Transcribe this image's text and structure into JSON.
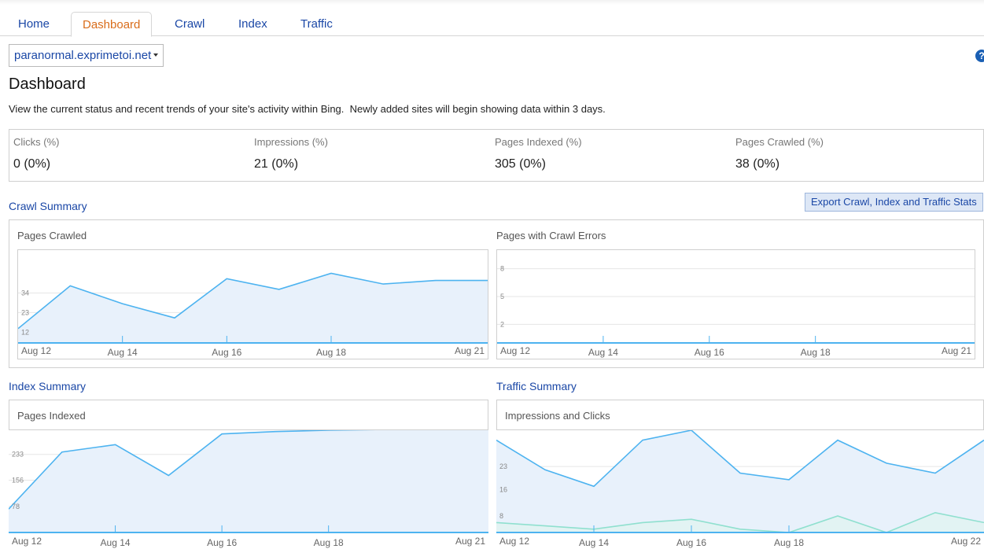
{
  "tabs": [
    {
      "label": "Home"
    },
    {
      "label": "Dashboard",
      "active": true
    },
    {
      "label": "Crawl"
    },
    {
      "label": "Index"
    },
    {
      "label": "Traffic"
    }
  ],
  "site_selector": {
    "value": "paranormal.exprimetoi.net"
  },
  "help_icon": {
    "glyph": "?"
  },
  "page": {
    "title": "Dashboard",
    "description": "View the current status and recent trends of your site's activity within Bing.  Newly added sites will begin showing data within 3 days."
  },
  "stats": [
    {
      "label": "Clicks (%)",
      "value": "0 (0%)"
    },
    {
      "label": "Impressions (%)",
      "value": "21 (0%)"
    },
    {
      "label": "Pages Indexed (%)",
      "value": "305 (0%)"
    },
    {
      "label": "Pages Crawled (%)",
      "value": "38 (0%)"
    }
  ],
  "crawl_summary": {
    "title": "Crawl Summary",
    "export_label": "Export Crawl, Index and Traffic Stats"
  },
  "index_summary": {
    "title": "Index Summary"
  },
  "traffic_summary": {
    "title": "Traffic Summary"
  },
  "colors": {
    "link": "#1a47a6",
    "active_tab": "#d96d1b",
    "series_main": "#4db3f0",
    "series_fill": "#e8f1fb",
    "series_clicks": "#8fe0cf"
  },
  "chart_data": [
    {
      "id": "pages_crawled",
      "type": "area",
      "title": "Pages Crawled",
      "x": [
        "Aug 12",
        "Aug 13",
        "Aug 14",
        "Aug 15",
        "Aug 16",
        "Aug 17",
        "Aug 18",
        "Aug 19",
        "Aug 20",
        "Aug 21"
      ],
      "x_tick_labels": [
        "Aug 12",
        "Aug 14",
        "Aug 16",
        "Aug 18",
        "Aug 21"
      ],
      "y_tick_labels": [
        12,
        23,
        34
      ],
      "ylim": [
        6,
        58
      ],
      "series": [
        {
          "values": [
            14,
            38,
            28,
            20,
            42,
            36,
            45,
            39,
            41,
            41
          ]
        }
      ]
    },
    {
      "id": "crawl_errors",
      "type": "area",
      "title": "Pages with Crawl Errors",
      "x": [
        "Aug 12",
        "Aug 13",
        "Aug 14",
        "Aug 15",
        "Aug 16",
        "Aug 17",
        "Aug 18",
        "Aug 19",
        "Aug 20",
        "Aug 21"
      ],
      "x_tick_labels": [
        "Aug 12",
        "Aug 14",
        "Aug 16",
        "Aug 18",
        "Aug 21"
      ],
      "y_tick_labels": [
        2,
        5,
        8
      ],
      "ylim": [
        0,
        10
      ],
      "series": [
        {
          "values": [
            0,
            0,
            0,
            0,
            0,
            0,
            0,
            0,
            0,
            0
          ]
        }
      ]
    },
    {
      "id": "pages_indexed",
      "type": "area",
      "title": "Pages Indexed",
      "x": [
        "Aug 12",
        "Aug 13",
        "Aug 14",
        "Aug 15",
        "Aug 16",
        "Aug 17",
        "Aug 18",
        "Aug 19",
        "Aug 20",
        "Aug 21"
      ],
      "x_tick_labels": [
        "Aug 12",
        "Aug 14",
        "Aug 16",
        "Aug 18",
        "Aug 21"
      ],
      "y_tick_labels": [
        78,
        156,
        233
      ],
      "ylim": [
        0,
        305
      ],
      "series": [
        {
          "values": [
            70,
            240,
            262,
            170,
            294,
            301,
            305,
            307,
            310,
            314
          ]
        }
      ]
    },
    {
      "id": "impressions_clicks",
      "type": "area",
      "title": "Impressions and Clicks",
      "x": [
        "Aug 12",
        "Aug 13",
        "Aug 14",
        "Aug 15",
        "Aug 16",
        "Aug 17",
        "Aug 18",
        "Aug 19",
        "Aug 20",
        "Aug 21",
        "Aug 22"
      ],
      "x_tick_labels": [
        "Aug 12",
        "Aug 14",
        "Aug 16",
        "Aug 18",
        "Aug 22"
      ],
      "y_tick_labels": [
        8,
        16,
        23
      ],
      "ylim": [
        3,
        34
      ],
      "series": [
        {
          "values": [
            31,
            22,
            17,
            31,
            34,
            21,
            19,
            31,
            24,
            21,
            31
          ]
        },
        {
          "values": [
            6,
            5,
            4,
            6,
            7,
            4,
            3,
            8,
            3,
            9,
            6
          ]
        }
      ]
    }
  ]
}
